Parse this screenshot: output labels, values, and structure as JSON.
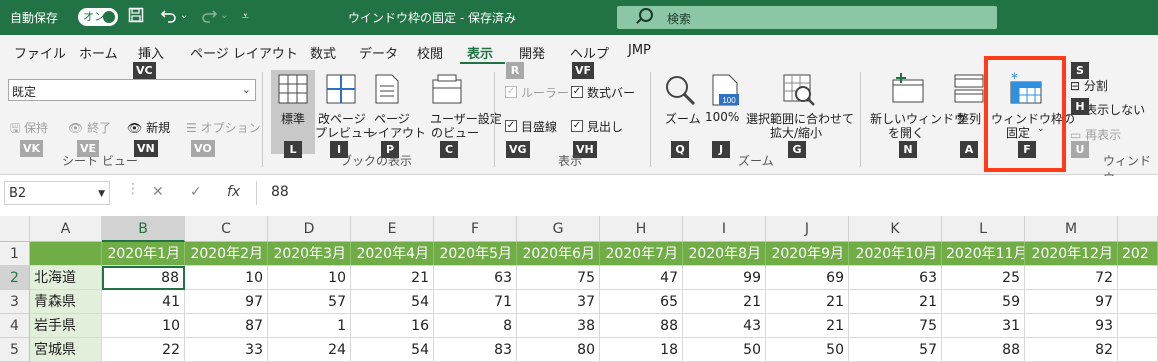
{
  "titlebar": {
    "autosave_label": "自動保存",
    "autosave_toggle": "オン",
    "title": "ウインドウ枠の固定 - 保存済み",
    "search_placeholder": "検索"
  },
  "menu": {
    "tabs": [
      "ファイル",
      "ホーム",
      "挿入",
      "ページ レイアウト",
      "数式",
      "データ",
      "校閲",
      "表示",
      "開発",
      "ヘルプ",
      "JMP"
    ],
    "active_tab": "表示"
  },
  "ribbon": {
    "sheet_view": {
      "dropdown_value": "既定",
      "keep": "保持",
      "exit": "終了",
      "new": "新規",
      "options": "オプション",
      "label": "シート ビュー",
      "keytips": [
        "VC",
        "VK",
        "VE",
        "VN",
        "VO"
      ]
    },
    "workbook_views": {
      "normal": "標準",
      "page_break": [
        "改ページ",
        "プレビュー"
      ],
      "page_layout": [
        "ページ",
        "レイアウト"
      ],
      "custom": [
        "ユーザー設定",
        "のビュー"
      ],
      "label": "ブックの表示",
      "keytips": [
        "L",
        "I",
        "P",
        "C"
      ]
    },
    "show": {
      "ruler": "ルーラー",
      "formula_bar": "数式バー",
      "gridlines": "目盛線",
      "headings": "見出し",
      "label": "表示",
      "keytips": [
        "R",
        "VF",
        "VG",
        "VH"
      ]
    },
    "zoom": {
      "zoom": "ズーム",
      "hundred": "100%",
      "zoom_selection": [
        "選択範囲に合わせて",
        "拡大/縮小"
      ],
      "label": "ズーム",
      "keytips": [
        "Q",
        "J",
        "G"
      ],
      "icon_100": "100"
    },
    "window": {
      "new_window": [
        "新しいウィンドウ",
        "を開く"
      ],
      "arrange": "整列",
      "freeze": [
        "ウィンドウ枠の",
        "固定"
      ],
      "split": "分割",
      "hide": "表示しない",
      "unhide": "再表示",
      "label": "ウィンドウ",
      "keytips": [
        "N",
        "A",
        "F",
        "S",
        "H",
        "U"
      ]
    }
  },
  "formula_bar": {
    "name_box": "B2",
    "cancel": "✕",
    "enter": "✓",
    "fx": "fx",
    "value": "88"
  },
  "sheet": {
    "col_headers": [
      "A",
      "B",
      "C",
      "D",
      "E",
      "F",
      "G",
      "H",
      "I",
      "J",
      "K",
      "L",
      "M",
      ""
    ],
    "row_headers": [
      "1",
      "2",
      "3",
      "4",
      "5"
    ],
    "header_row": [
      "",
      "2020年1月",
      "2020年2月",
      "2020年3月",
      "2020年4月",
      "2020年5月",
      "2020年6月",
      "2020年7月",
      "2020年8月",
      "2020年9月",
      "2020年10月",
      "2020年11月",
      "2020年12月",
      "202"
    ],
    "rows": [
      {
        "pref": "北海道",
        "values": [
          "88",
          "10",
          "10",
          "21",
          "63",
          "75",
          "47",
          "99",
          "69",
          "63",
          "25",
          "72",
          ""
        ]
      },
      {
        "pref": "青森県",
        "values": [
          "41",
          "97",
          "57",
          "54",
          "71",
          "37",
          "65",
          "21",
          "21",
          "21",
          "59",
          "97",
          ""
        ]
      },
      {
        "pref": "岩手県",
        "values": [
          "10",
          "87",
          "1",
          "16",
          "8",
          "38",
          "88",
          "43",
          "21",
          "75",
          "31",
          "93",
          ""
        ]
      },
      {
        "pref": "宮城県",
        "values": [
          "22",
          "33",
          "24",
          "54",
          "83",
          "80",
          "18",
          "50",
          "50",
          "57",
          "88",
          "82",
          ""
        ]
      }
    ]
  }
}
